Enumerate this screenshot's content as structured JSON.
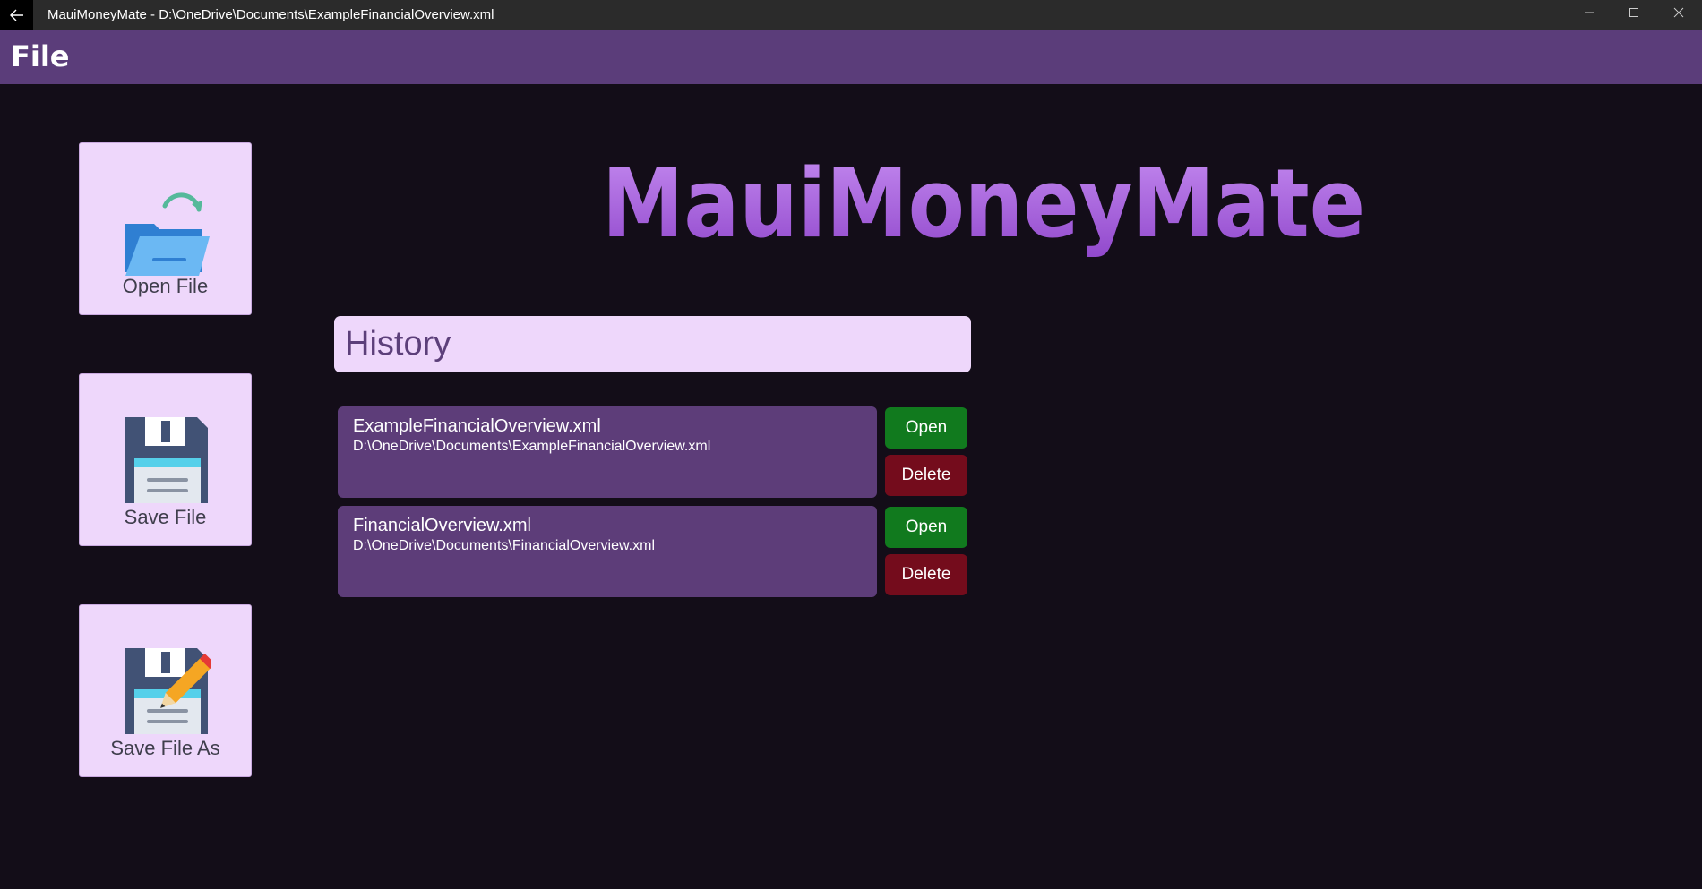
{
  "window": {
    "title": "MauiMoneyMate - D:\\OneDrive\\Documents\\ExampleFinancialOverview.xml"
  },
  "header": {
    "title": "File"
  },
  "actions": [
    {
      "label": "Open File",
      "icon": "folder-open-icon"
    },
    {
      "label": "Save File",
      "icon": "floppy-disk-icon"
    },
    {
      "label": "Save File As",
      "icon": "floppy-disk-pencil-icon"
    }
  ],
  "logo": {
    "text": "MauiMoneyMate",
    "color": "#a865d8"
  },
  "history": {
    "title": "History",
    "items": [
      {
        "name": "ExampleFinancialOverview.xml",
        "path": "D:\\OneDrive\\Documents\\ExampleFinancialOverview.xml",
        "open_label": "Open",
        "delete_label": "Delete"
      },
      {
        "name": "FinancialOverview.xml",
        "path": "D:\\OneDrive\\Documents\\FinancialOverview.xml",
        "open_label": "Open",
        "delete_label": "Delete"
      }
    ]
  },
  "colors": {
    "background": "#130d18",
    "accent": "#5b3d7a",
    "tile": "#eed7fb",
    "open_button": "#117a1e",
    "delete_button": "#740c1c"
  }
}
